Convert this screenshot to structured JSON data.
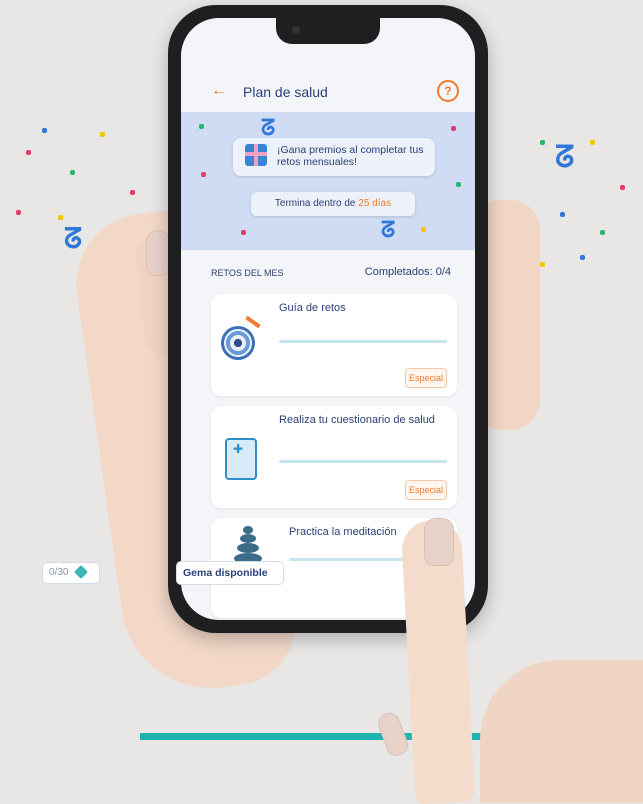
{
  "app": {
    "title": "Plan de salud"
  },
  "banner": {
    "promo_text": "¡Gana premios al completar tus retos mensuales!",
    "deadline_prefix": "Termina dentro de ",
    "deadline_days": "25 días"
  },
  "section": {
    "heading": "RETOS DEL MES",
    "completed": "Completados: 0/4"
  },
  "challenges": [
    {
      "title": "Guía de retos",
      "badge": "Especial",
      "icon": "target-icon"
    },
    {
      "title": "Realiza tu cuestionario de salud",
      "badge": "Especial",
      "icon": "health-form-icon"
    },
    {
      "title": "Practica la meditación",
      "icon": "stacked-stones-icon"
    }
  ],
  "footer": {
    "counter": "0/30",
    "gem_button": "Gema disponible"
  },
  "colors": {
    "accent": "#f07a2e",
    "primary_text": "#2b3f75",
    "banner_bg": "#cfdcf3",
    "teal_line": "#1fb3b0"
  }
}
